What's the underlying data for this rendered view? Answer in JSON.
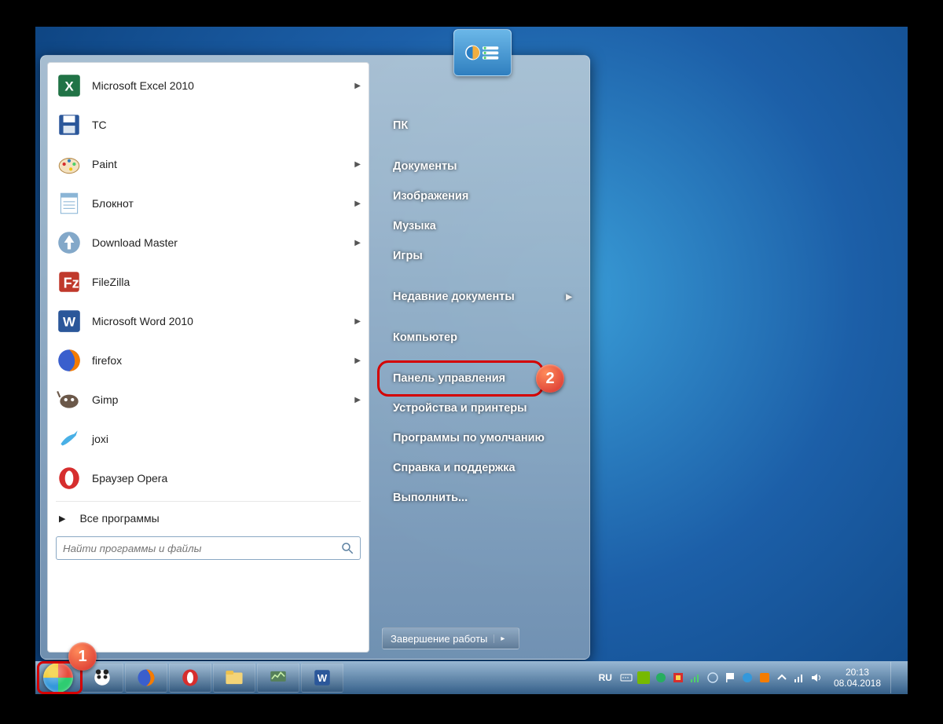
{
  "programs": [
    {
      "label": "Microsoft Excel 2010",
      "icon": "excel",
      "arrow": true
    },
    {
      "label": "TC",
      "icon": "save",
      "arrow": false
    },
    {
      "label": "Paint",
      "icon": "paint",
      "arrow": true
    },
    {
      "label": "Блокнот",
      "icon": "notepad",
      "arrow": true
    },
    {
      "label": "Download Master",
      "icon": "dm",
      "arrow": true
    },
    {
      "label": "FileZilla",
      "icon": "filezilla",
      "arrow": false
    },
    {
      "label": "Microsoft Word 2010",
      "icon": "word",
      "arrow": true
    },
    {
      "label": "firefox",
      "icon": "firefox",
      "arrow": true
    },
    {
      "label": "Gimp",
      "icon": "gimp",
      "arrow": true
    },
    {
      "label": "joxi",
      "icon": "joxi",
      "arrow": false
    },
    {
      "label": "Браузер Opera",
      "icon": "opera",
      "arrow": false
    }
  ],
  "all_programs": "Все программы",
  "search_placeholder": "Найти программы и файлы",
  "right_items": [
    {
      "label": "ПК",
      "arrow": false
    },
    {
      "label": "Документы",
      "arrow": false
    },
    {
      "label": "Изображения",
      "arrow": false
    },
    {
      "label": "Музыка",
      "arrow": false
    },
    {
      "label": "Игры",
      "arrow": false
    },
    {
      "label": "Недавние документы",
      "arrow": true
    },
    {
      "label": "Компьютер",
      "arrow": false
    },
    {
      "label": "Панель управления",
      "arrow": false
    },
    {
      "label": "Устройства и принтеры",
      "arrow": false
    },
    {
      "label": "Программы по умолчанию",
      "arrow": false
    },
    {
      "label": "Справка и поддержка",
      "arrow": false
    },
    {
      "label": "Выполнить...",
      "arrow": false
    }
  ],
  "shutdown_label": "Завершение работы",
  "lang": "RU",
  "time": "20:13",
  "date": "08.04.2018",
  "annotation": {
    "badge1": "1",
    "badge2": "2"
  }
}
